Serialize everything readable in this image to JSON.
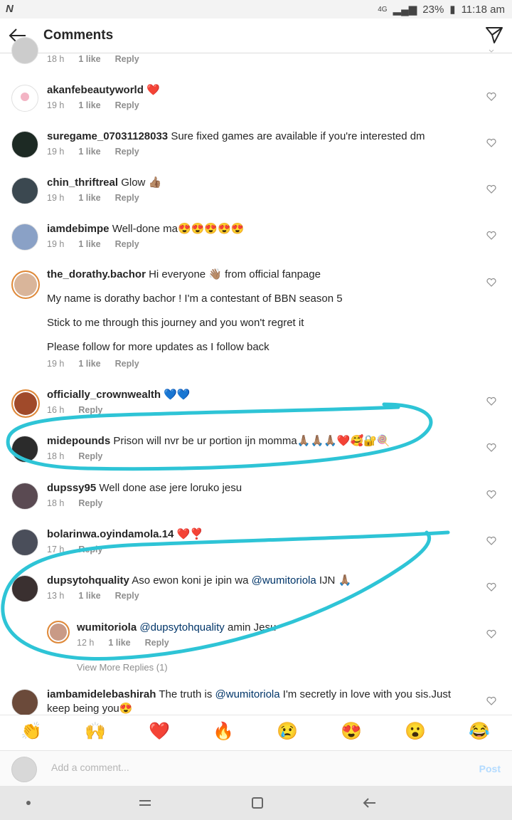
{
  "status": {
    "carrier": "N",
    "network": "4G",
    "battery": "23%",
    "time": "11:18 am"
  },
  "header": {
    "title": "Comments"
  },
  "comments": [
    {
      "user": "",
      "text": "",
      "time": "18 h",
      "likes": "1 like",
      "reply": "Reply"
    },
    {
      "user": "akanfebeautyworld",
      "text": "❤️",
      "time": "19 h",
      "likes": "1 like",
      "reply": "Reply"
    },
    {
      "user": "suregame_07031128033",
      "text": "Sure fixed games are available if you're interested dm",
      "time": "19 h",
      "likes": "1 like",
      "reply": "Reply"
    },
    {
      "user": "chin_thriftreal",
      "text": "Glow 👍🏽",
      "time": "19 h",
      "likes": "1 like",
      "reply": "Reply"
    },
    {
      "user": "iamdebimpe",
      "text": "Well-done ma😍😍😍😍😍",
      "time": "19 h",
      "likes": "1 like",
      "reply": "Reply"
    },
    {
      "user": "the_dorathy.bachor",
      "text": "Hi everyone 👋🏽 from official fanpage",
      "paragraphs": [
        "My name is dorathy bachor ! I'm a contestant of BBN season 5",
        "Stick to me through this journey and you won't regret it",
        "Please follow for more updates as I follow back"
      ],
      "time": "19 h",
      "likes": "1 like",
      "reply": "Reply"
    },
    {
      "user": "officially_crownwealth",
      "text": "💙💙",
      "time": "16 h",
      "likes": "",
      "reply": "Reply"
    },
    {
      "user": "midepounds",
      "text": "Prison will nvr be ur portion ijn momma🙏🏽🙏🏽🙏🏽❤️🥰🔐🍭",
      "time": "18 h",
      "likes": "",
      "reply": "Reply"
    },
    {
      "user": "dupssy95",
      "text": "Well done ase jere loruko jesu",
      "time": "18 h",
      "likes": "",
      "reply": "Reply"
    },
    {
      "user": "bolarinwa.oyindamola.14",
      "text": "❤️❣️",
      "time": "17 h",
      "likes": "",
      "reply": "Reply"
    },
    {
      "user": "dupsytohquality",
      "text_before": "Aso ewon koni je ipin wa ",
      "mention": "@wumitoriola",
      "text_after": " IJN 🙏🏽",
      "time": "13 h",
      "likes": "1 like",
      "reply": "Reply"
    },
    {
      "user": "wumitoriola",
      "mention": "@dupsytohquality",
      "text_after": " amin Jesu",
      "time": "12 h",
      "likes": "1 like",
      "reply": "Reply"
    },
    {
      "user": "iambamidelebashirah",
      "text_before": "The truth is ",
      "mention": "@wumitoriola",
      "text_after": " I'm secretly in love with you sis.Just keep being you😍"
    }
  ],
  "view_more": "View More Replies (1)",
  "emoji_bar": [
    "👏",
    "🙌",
    "❤️",
    "🔥",
    "😢",
    "😍",
    "😮",
    "😂"
  ],
  "composer": {
    "placeholder": "Add a comment...",
    "post": "Post"
  },
  "colors": {
    "scribble": "#2ec4d6",
    "mention": "#003569",
    "post": "#b3dbff"
  }
}
